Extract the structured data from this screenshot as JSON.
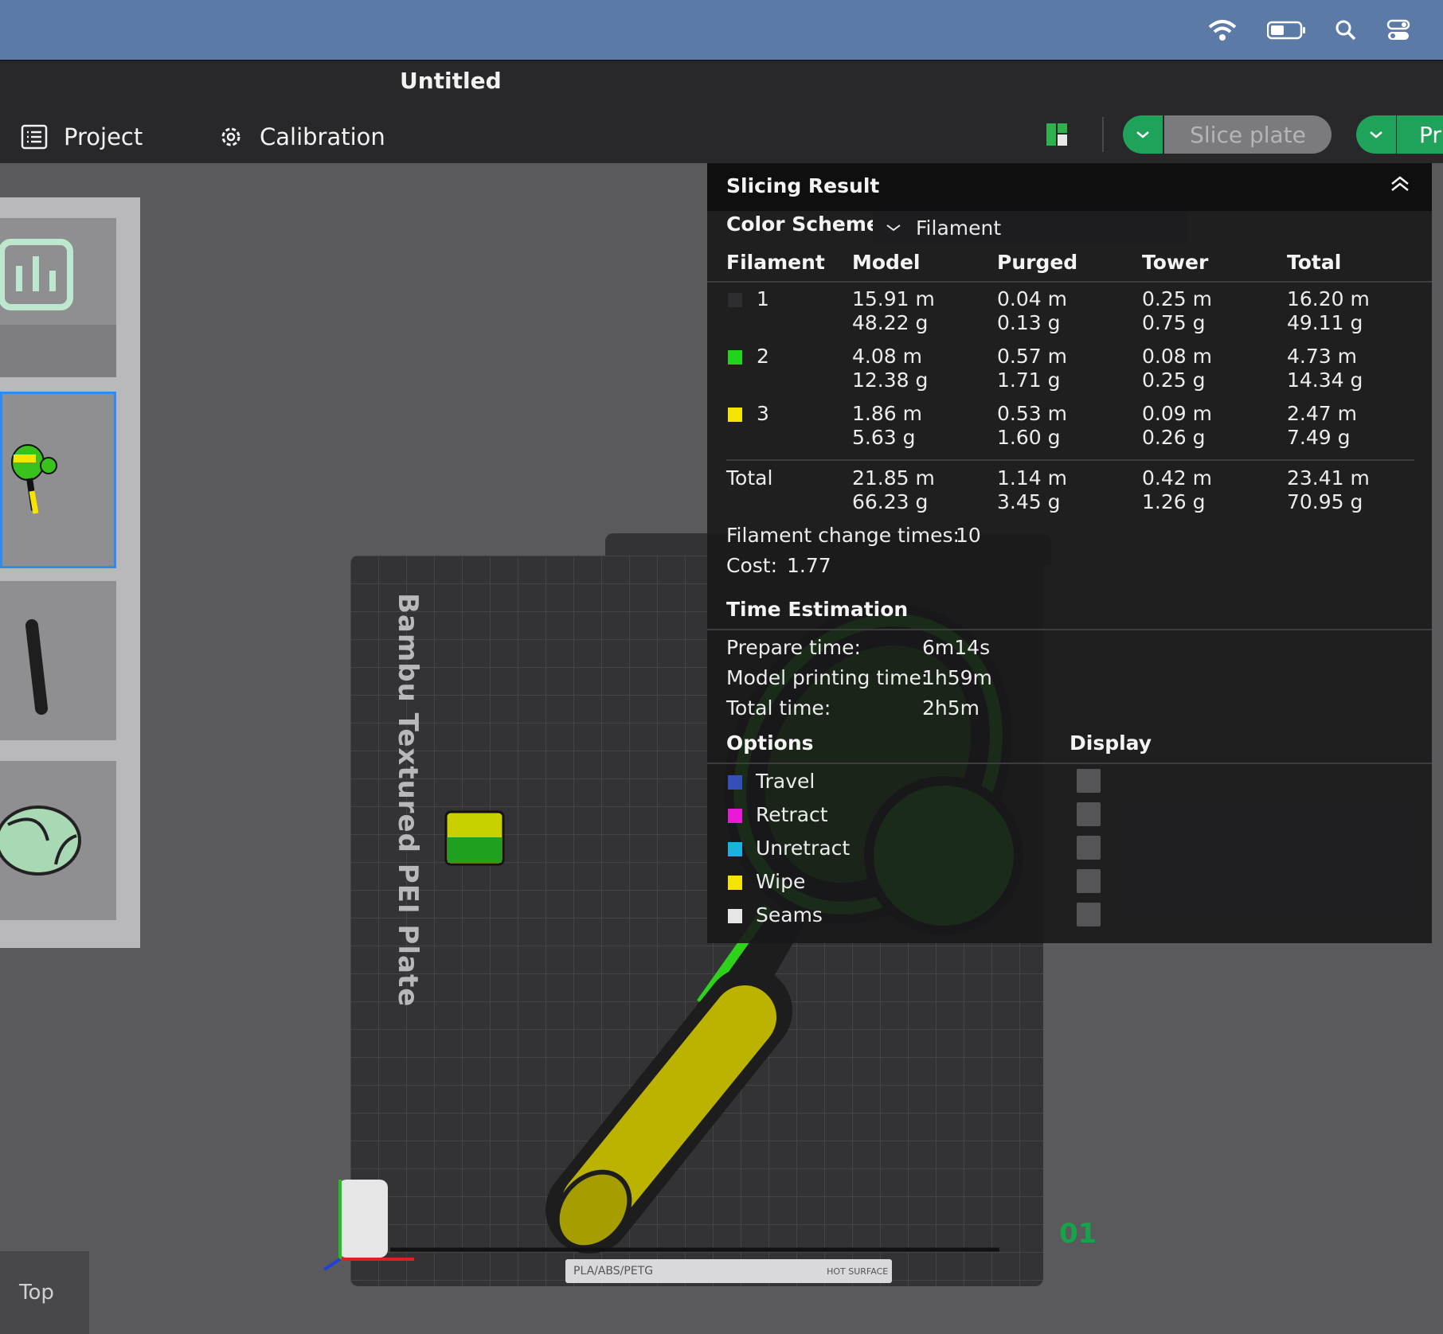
{
  "menubar": {
    "icons": [
      "wifi-icon",
      "battery-icon",
      "search-icon",
      "control-center-icon"
    ],
    "colors": {
      "bg": "#5b7aa6"
    }
  },
  "window": {
    "title": "Untitled"
  },
  "toolbar": {
    "project_label": "Project",
    "calibration_label": "Calibration",
    "slice_label": "Slice plate",
    "print_label": "Pr"
  },
  "viewport": {
    "bed_name": "Bambu Textured PEI Plate",
    "plate_number": "01",
    "strip_text": "PLA/ABS/PETG",
    "hot_surface_text": "HOT SURFACE",
    "view_label": "Top"
  },
  "slicing_result": {
    "title": "Slicing Result",
    "color_scheme_label": "Color Scheme",
    "color_scheme_value": "Filament",
    "headers": [
      "Filament",
      "Model",
      "Purged",
      "Tower",
      "Total"
    ],
    "rows": [
      {
        "id": "1",
        "color": "#2e2e30",
        "model": [
          "15.91 m",
          "48.22 g"
        ],
        "purged": [
          "0.04 m",
          "0.13 g"
        ],
        "tower": [
          "0.25 m",
          "0.75 g"
        ],
        "total": [
          "16.20 m",
          "49.11 g"
        ]
      },
      {
        "id": "2",
        "color": "#22d31e",
        "model": [
          "4.08 m",
          "12.38 g"
        ],
        "purged": [
          "0.57 m",
          "1.71 g"
        ],
        "tower": [
          "0.08 m",
          "0.25 g"
        ],
        "total": [
          "4.73 m",
          "14.34 g"
        ]
      },
      {
        "id": "3",
        "color": "#f5e400",
        "model": [
          "1.86 m",
          "5.63 g"
        ],
        "purged": [
          "0.53 m",
          "1.60 g"
        ],
        "tower": [
          "0.09 m",
          "0.26 g"
        ],
        "total": [
          "2.47 m",
          "7.49 g"
        ]
      }
    ],
    "total_row": {
      "label": "Total",
      "model": [
        "21.85 m",
        "66.23 g"
      ],
      "purged": [
        "1.14 m",
        "3.45 g"
      ],
      "tower": [
        "0.42 m",
        "1.26 g"
      ],
      "total": [
        "23.41 m",
        "70.95 g"
      ]
    },
    "filament_change_label": "Filament change times:",
    "filament_change_value": "10",
    "cost_label": "Cost:",
    "cost_value": "1.77",
    "time_title": "Time Estimation",
    "times": [
      {
        "label": "Prepare time:",
        "value": "6m14s"
      },
      {
        "label": "Model printing time:",
        "value": "1h59m"
      },
      {
        "label": "Total time:",
        "value": "2h5m"
      }
    ],
    "options_title": "Options",
    "display_title": "Display",
    "options": [
      {
        "label": "Travel",
        "color": "#3450b8"
      },
      {
        "label": "Retract",
        "color": "#e81ad8"
      },
      {
        "label": "Unretract",
        "color": "#1ab0e0"
      },
      {
        "label": "Wipe",
        "color": "#f5e400"
      },
      {
        "label": "Seams",
        "color": "#e6e6e6"
      }
    ]
  }
}
